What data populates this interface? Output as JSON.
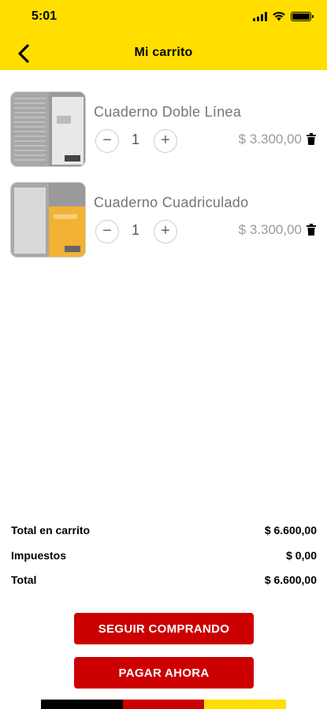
{
  "status_bar": {
    "time": "5:01"
  },
  "header": {
    "title": "Mi carrito",
    "back_icon": "chevron-left-icon"
  },
  "cart": {
    "items": [
      {
        "name": "Cuaderno Doble Línea",
        "quantity": "1",
        "price": "$ 3.300,00",
        "cover_color": "#e8e8e8"
      },
      {
        "name": "Cuaderno Cuadriculado",
        "quantity": "1",
        "price": "$ 3.300,00",
        "cover_color": "#F2B233"
      }
    ],
    "minus_symbol": "−",
    "plus_symbol": "+"
  },
  "totals": {
    "cart_label": "Total en carrito",
    "cart_value": "$ 6.600,00",
    "tax_label": "Impuestos",
    "tax_value": "$ 0,00",
    "total_label": "Total",
    "total_value": "$ 6.600,00"
  },
  "actions": {
    "continue_label": "SEGUIR COMPRANDO",
    "pay_label": "PAGAR AHORA"
  },
  "colors": {
    "header": "#FFDE00",
    "button": "#CC0000",
    "flag": [
      "#000000",
      "#CC0000",
      "#FFDE00"
    ]
  }
}
